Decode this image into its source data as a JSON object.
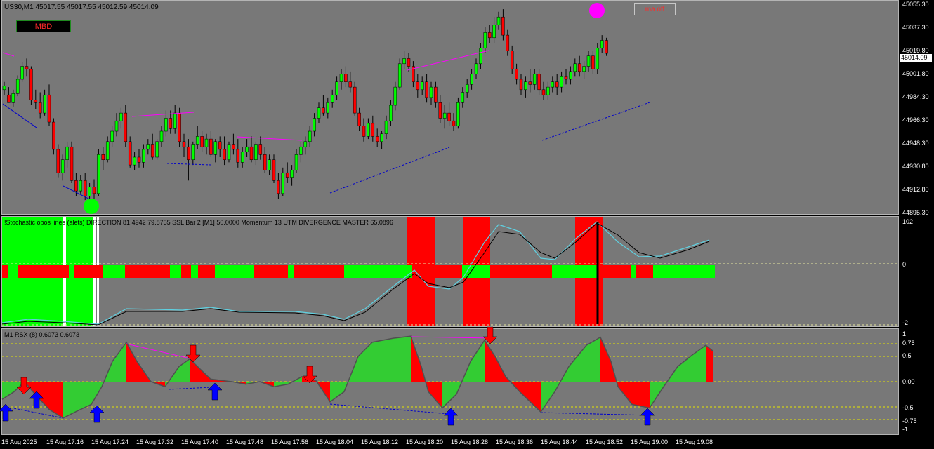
{
  "main": {
    "header": "US30,M1  45017.55 45017.55 45012.59 45014.09",
    "current_price": "45014.09",
    "buttons": {
      "mbd": "MBD",
      "ma_off": "ma off"
    },
    "price_labels": [
      "45055.30",
      "45037.30",
      "45019.80",
      "45001.80",
      "44984.30",
      "44966.30",
      "44948.30",
      "44930.80",
      "44912.80",
      "44895.30"
    ]
  },
  "stoch": {
    "header": "!Stochastic obos lines (alets) DIRECTION 81.4942 79.8755  SSL Bar 2 [M1] 50.0000  Momentum 13 UTM DIVERGENCE MASTER 65.0896",
    "axis_labels": [
      "102",
      "0",
      "-2"
    ]
  },
  "rsx": {
    "header": "M1  RSX (8) 0.6073 0.6073",
    "axis_labels": [
      "1",
      "0.75",
      "0.5",
      "0.00",
      "-0.5",
      "-0.75",
      "-1"
    ]
  },
  "time_labels": [
    "15 Aug 2025",
    "15 Aug 17:16",
    "15 Aug 17:24",
    "15 Aug 17:32",
    "15 Aug 17:40",
    "15 Aug 17:48",
    "15 Aug 17:56",
    "15 Aug 18:04",
    "15 Aug 18:12",
    "15 Aug 18:20",
    "15 Aug 18:28",
    "15 Aug 18:36",
    "15 Aug 18:44",
    "15 Aug 18:52",
    "15 Aug 19:00",
    "15 Aug 19:08"
  ],
  "colors": {
    "bull": "#00ff00",
    "bear": "#ff0000",
    "pane_bg": "#787878",
    "signal_magenta": "#ff00ff",
    "signal_green": "#00ff00",
    "arrow_up": "#0000ff",
    "arrow_down": "#ff0000"
  },
  "chart_data": {
    "type": "candlestick",
    "symbol": "US30",
    "timeframe": "M1",
    "ylim": [
      44895.3,
      45055.3
    ],
    "ohlc": [
      [
        44990,
        44996,
        44986,
        44993
      ],
      [
        44986,
        44992,
        44980,
        44980
      ],
      [
        44980,
        44990,
        44977,
        44987
      ],
      [
        44987,
        45001,
        44985,
        44998
      ],
      [
        44998,
        45011,
        44996,
        45008
      ],
      [
        45008,
        45014,
        45000,
        45006
      ],
      [
        45006,
        45008,
        44978,
        44982
      ],
      [
        44982,
        44990,
        44975,
        44980
      ],
      [
        44980,
        44988,
        44968,
        44972
      ],
      [
        44972,
        44990,
        44970,
        44986
      ],
      [
        44986,
        44994,
        44962,
        44965
      ],
      [
        44965,
        44968,
        44940,
        44944
      ],
      [
        44944,
        44948,
        44922,
        44926
      ],
      [
        44926,
        44940,
        44920,
        44936
      ],
      [
        44936,
        44950,
        44930,
        44946
      ],
      [
        44946,
        44950,
        44918,
        44920
      ],
      [
        44920,
        44926,
        44908,
        44912
      ],
      [
        44912,
        44924,
        44910,
        44920
      ],
      [
        44920,
        44926,
        44905,
        44908
      ],
      [
        44908,
        44918,
        44904,
        44915
      ],
      [
        44915,
        44921,
        44904,
        44910
      ],
      [
        44910,
        44944,
        44908,
        44940
      ],
      [
        44940,
        44946,
        44928,
        44936
      ],
      [
        44936,
        44954,
        44934,
        44950
      ],
      [
        44950,
        44962,
        44946,
        44958
      ],
      [
        44958,
        44972,
        44954,
        44966
      ],
      [
        44966,
        44976,
        44960,
        44972
      ],
      [
        44972,
        44978,
        44946,
        44950
      ],
      [
        44950,
        44954,
        44930,
        44932
      ],
      [
        44932,
        44942,
        44928,
        44938
      ],
      [
        44938,
        44944,
        44930,
        44934
      ],
      [
        44934,
        44948,
        44930,
        44944
      ],
      [
        44944,
        44952,
        44940,
        44948
      ],
      [
        44948,
        44956,
        44936,
        44938
      ],
      [
        44938,
        44952,
        44936,
        44950
      ],
      [
        44950,
        44962,
        44946,
        44958
      ],
      [
        44958,
        44974,
        44954,
        44968
      ],
      [
        44968,
        44974,
        44956,
        44960
      ],
      [
        44960,
        44978,
        44956,
        44972
      ],
      [
        44972,
        44976,
        44946,
        44950
      ],
      [
        44950,
        44956,
        44938,
        44946
      ],
      [
        44946,
        44952,
        44920,
        44936
      ],
      [
        44936,
        44950,
        44932,
        44948
      ],
      [
        44948,
        44962,
        44944,
        44954
      ],
      [
        44954,
        44958,
        44942,
        44946
      ],
      [
        44946,
        44956,
        44940,
        44952
      ],
      [
        44952,
        44958,
        44938,
        44940
      ],
      [
        44940,
        44952,
        44934,
        44950
      ],
      [
        44950,
        44954,
        44938,
        44944
      ],
      [
        44944,
        44954,
        44932,
        44936
      ],
      [
        44936,
        44950,
        44934,
        44948
      ],
      [
        44948,
        44956,
        44940,
        44944
      ],
      [
        44944,
        44952,
        44930,
        44934
      ],
      [
        44934,
        44946,
        44930,
        44942
      ],
      [
        44942,
        44952,
        44938,
        44946
      ],
      [
        44946,
        44954,
        44934,
        44936
      ],
      [
        44936,
        44950,
        44932,
        44948
      ],
      [
        44948,
        44954,
        44936,
        44940
      ],
      [
        44940,
        44946,
        44926,
        44928
      ],
      [
        44928,
        44940,
        44924,
        44936
      ],
      [
        44936,
        44940,
        44918,
        44920
      ],
      [
        44920,
        44926,
        44906,
        44910
      ],
      [
        44910,
        44930,
        44908,
        44926
      ],
      [
        44926,
        44934,
        44918,
        44922
      ],
      [
        44922,
        44932,
        44916,
        44928
      ],
      [
        44928,
        44944,
        44926,
        44940
      ],
      [
        44940,
        44950,
        44934,
        44946
      ],
      [
        44946,
        44954,
        44940,
        44950
      ],
      [
        44950,
        44962,
        44946,
        44958
      ],
      [
        44958,
        44972,
        44954,
        44968
      ],
      [
        44968,
        44980,
        44964,
        44976
      ],
      [
        44976,
        44986,
        44970,
        44972
      ],
      [
        44972,
        44984,
        44968,
        44980
      ],
      [
        44980,
        44990,
        44976,
        44986
      ],
      [
        44986,
        45000,
        44982,
        44996
      ],
      [
        44996,
        45006,
        44990,
        45002
      ],
      [
        45002,
        45008,
        44992,
        44996
      ],
      [
        44996,
        45004,
        44988,
        44992
      ],
      [
        44992,
        44996,
        44970,
        44972
      ],
      [
        44972,
        44976,
        44958,
        44962
      ],
      [
        44962,
        44968,
        44950,
        44954
      ],
      [
        44954,
        44968,
        44952,
        44964
      ],
      [
        44964,
        44970,
        44950,
        44954
      ],
      [
        44954,
        44960,
        44946,
        44950
      ],
      [
        44950,
        44958,
        44944,
        44956
      ],
      [
        44956,
        44970,
        44952,
        44966
      ],
      [
        44966,
        44982,
        44962,
        44978
      ],
      [
        44978,
        44996,
        44974,
        44992
      ],
      [
        44992,
        45014,
        44990,
        45010
      ],
      [
        45010,
        45020,
        45006,
        45014
      ],
      [
        45014,
        45018,
        45004,
        45008
      ],
      [
        45008,
        45012,
        44992,
        44996
      ],
      [
        44996,
        45002,
        44984,
        44990
      ],
      [
        44990,
        45000,
        44986,
        44996
      ],
      [
        44996,
        45002,
        44980,
        44984
      ],
      [
        44984,
        44996,
        44978,
        44992
      ],
      [
        44992,
        44996,
        44976,
        44980
      ],
      [
        44980,
        44986,
        44964,
        44968
      ],
      [
        44968,
        44978,
        44960,
        44972
      ],
      [
        44972,
        44980,
        44962,
        44966
      ],
      [
        44966,
        44972,
        44958,
        44962
      ],
      [
        44962,
        44984,
        44960,
        44980
      ],
      [
        44980,
        44992,
        44976,
        44988
      ],
      [
        44988,
        44998,
        44984,
        44994
      ],
      [
        44994,
        45006,
        44990,
        45002
      ],
      [
        45002,
        45014,
        44998,
        45010
      ],
      [
        45010,
        45026,
        45006,
        45022
      ],
      [
        45022,
        45038,
        45018,
        45034
      ],
      [
        45034,
        45040,
        45026,
        45030
      ],
      [
        45030,
        45046,
        45026,
        45040
      ],
      [
        45040,
        45050,
        45036,
        45046
      ],
      [
        45046,
        45052,
        45028,
        45032
      ],
      [
        45032,
        45036,
        45016,
        45020
      ],
      [
        45020,
        45024,
        45002,
        45006
      ],
      [
        45006,
        45010,
        44994,
        44998
      ],
      [
        44998,
        45002,
        44986,
        44990
      ],
      [
        44990,
        45000,
        44984,
        44996
      ],
      [
        44996,
        45006,
        44988,
        44994
      ],
      [
        44994,
        45006,
        44990,
        45002
      ],
      [
        45002,
        45006,
        44986,
        44990
      ],
      [
        44990,
        44996,
        44982,
        44986
      ],
      [
        44986,
        44996,
        44982,
        44992
      ],
      [
        44992,
        45000,
        44988,
        44996
      ],
      [
        44996,
        45002,
        44986,
        44992
      ],
      [
        44992,
        45004,
        44988,
        45000
      ],
      [
        45000,
        45006,
        44994,
        44998
      ],
      [
        44998,
        45008,
        44994,
        45004
      ],
      [
        45004,
        45014,
        45000,
        45010
      ],
      [
        45010,
        45016,
        45000,
        45004
      ],
      [
        45004,
        45012,
        44998,
        45008
      ],
      [
        45008,
        45020,
        45004,
        45016
      ],
      [
        45016,
        45020,
        45002,
        45006
      ],
      [
        45006,
        45026,
        45002,
        45022
      ],
      [
        45022,
        45032,
        45018,
        45028
      ],
      [
        45028,
        45030,
        45016,
        45018
      ]
    ]
  }
}
